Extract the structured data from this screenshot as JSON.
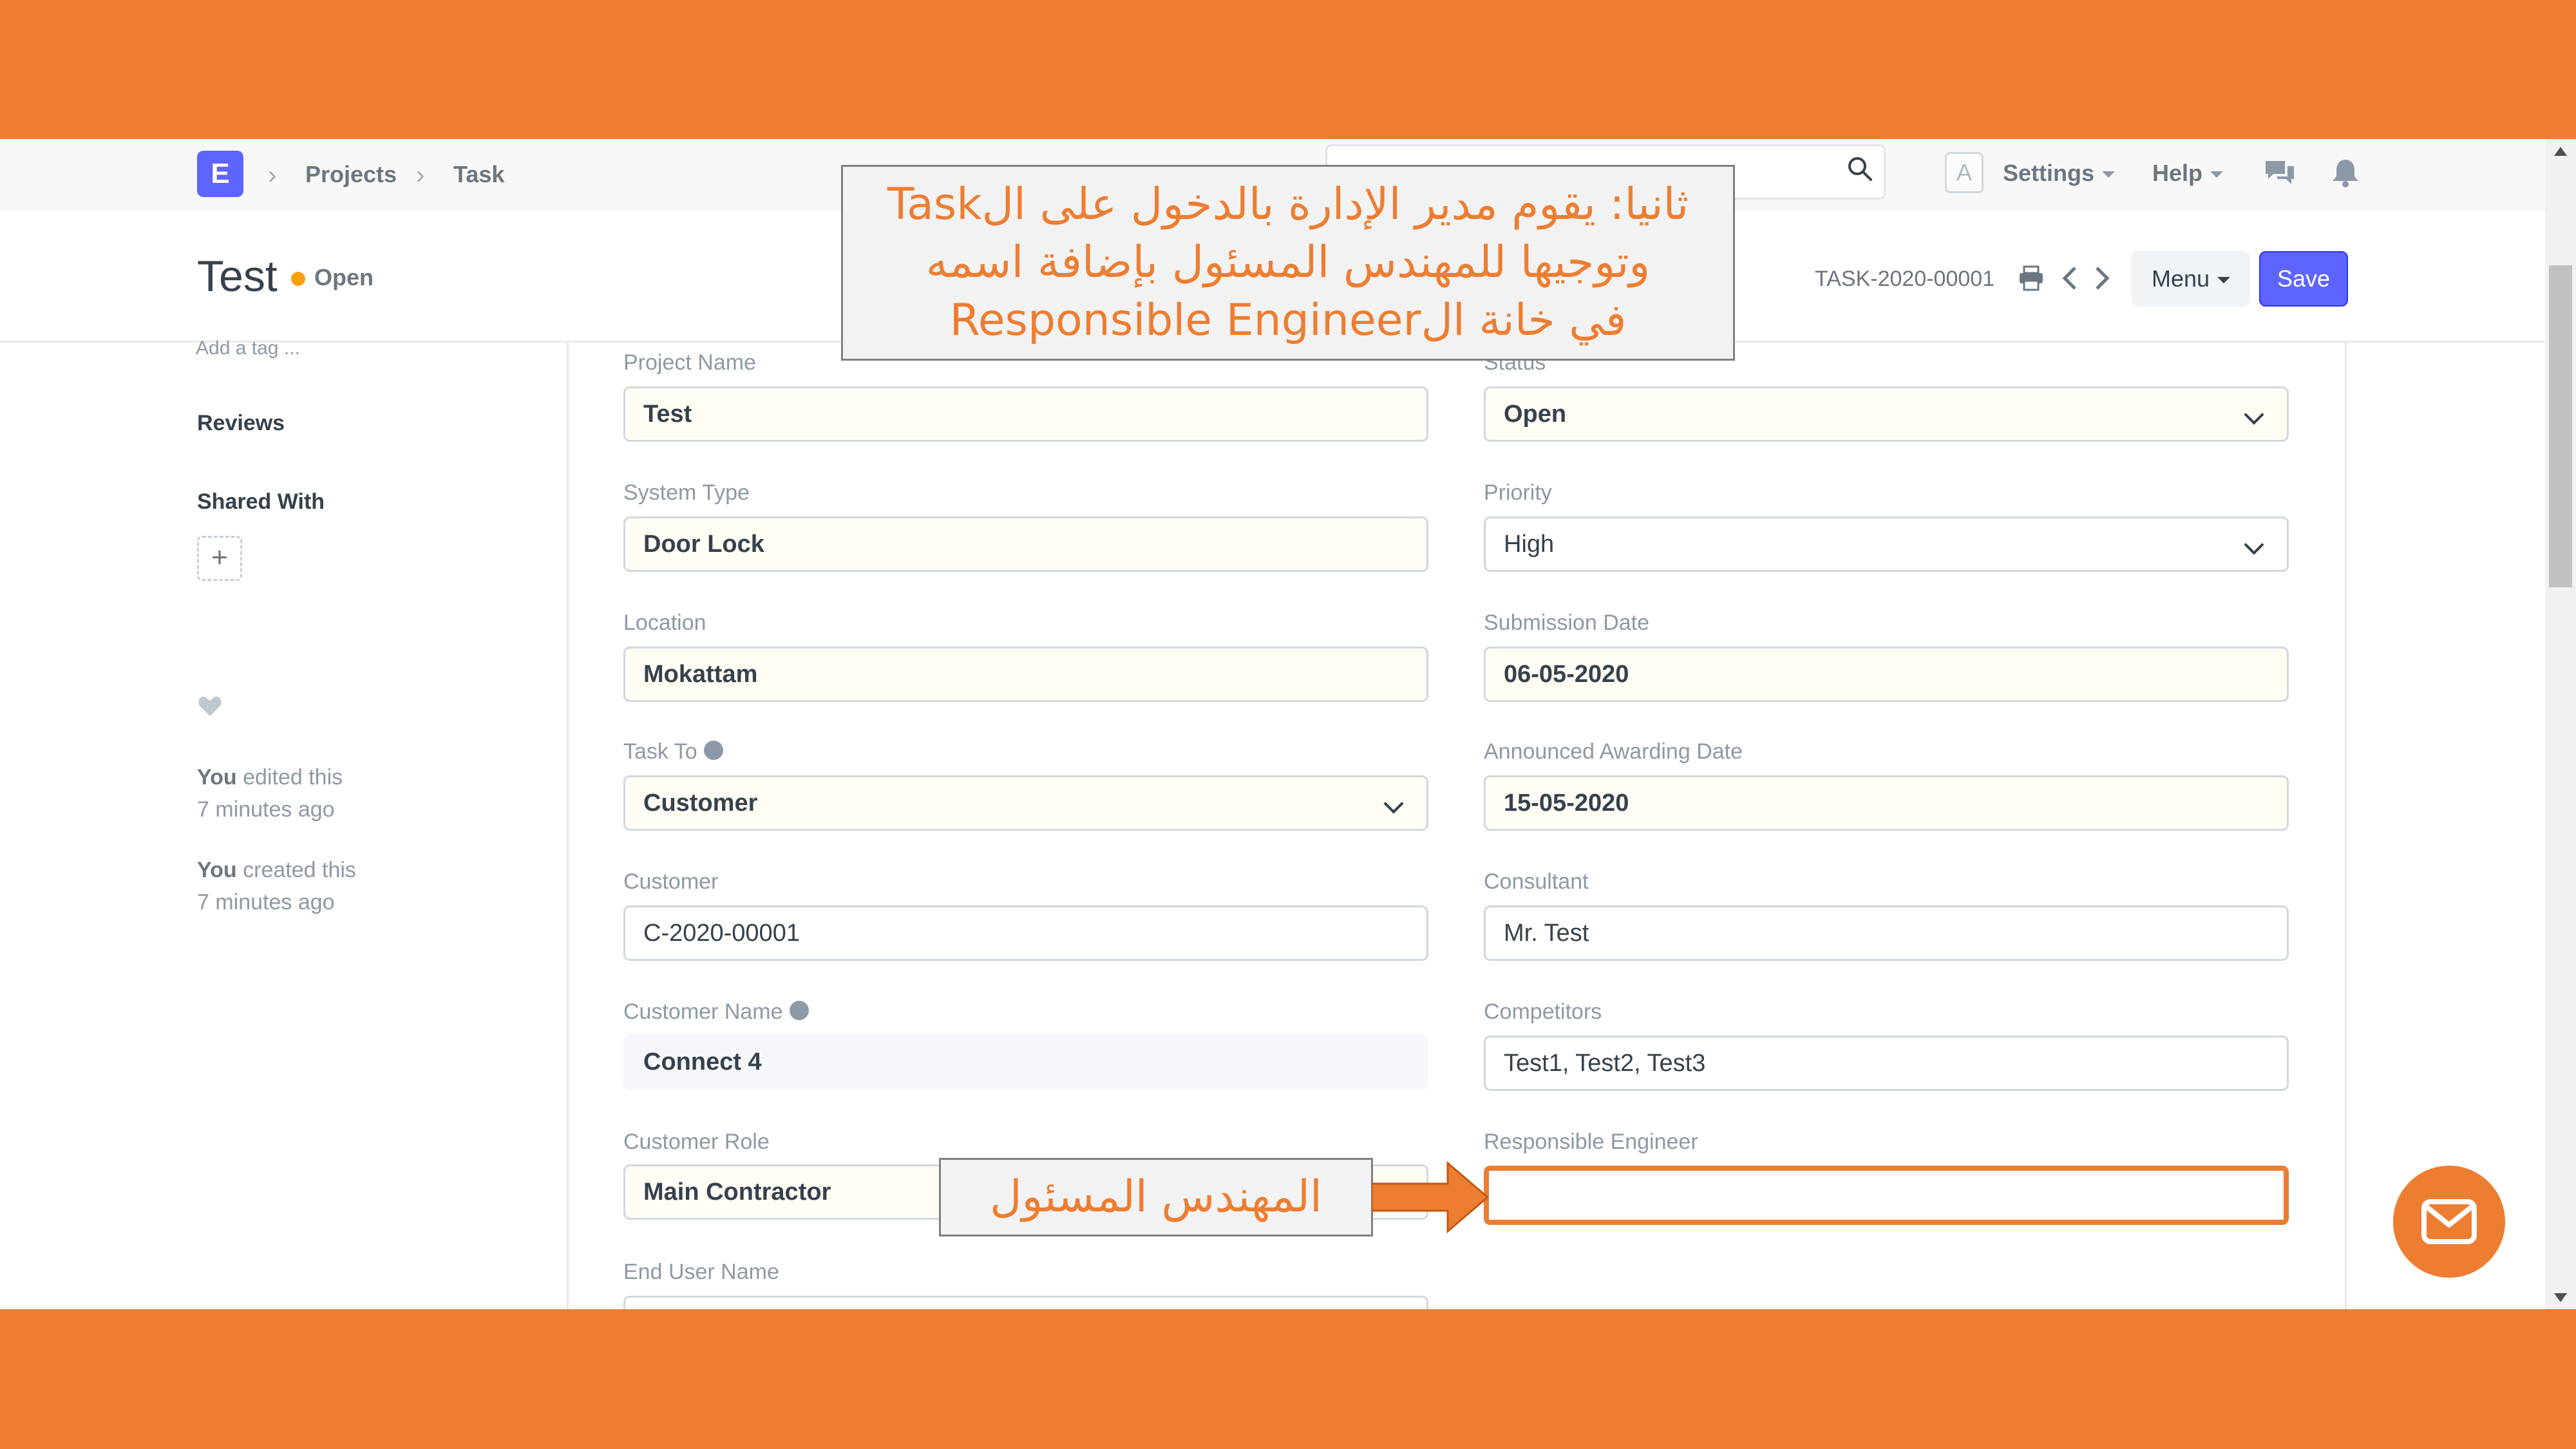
{
  "navbar": {
    "logo_letter": "E",
    "breadcrumbs": [
      "Projects",
      "Task"
    ],
    "avatar_letter": "A",
    "settings_label": "Settings",
    "help_label": "Help"
  },
  "page": {
    "title": "Test",
    "status": "Open",
    "doc_name": "TASK-2020-00001",
    "menu_label": "Menu",
    "save_label": "Save",
    "colors": {
      "primary": "#5e64ff",
      "status_dot": "#ffa00a",
      "highlight": "#ED7D31"
    }
  },
  "sidebar": {
    "add_tag": "Add a tag ...",
    "reviews": "Reviews",
    "shared_with": "Shared With",
    "add_share": "+",
    "activity": [
      {
        "who": "You",
        "action": " edited this",
        "when": "7 minutes ago"
      },
      {
        "who": "You",
        "action": " created this",
        "when": "7 minutes ago"
      }
    ]
  },
  "form": {
    "left": [
      {
        "label": "Project Name",
        "value": "Test"
      },
      {
        "label": "System Type",
        "value": "Door Lock"
      },
      {
        "label": "Location",
        "value": "Mokattam"
      },
      {
        "label": "Task To",
        "value": "Customer"
      },
      {
        "label": "Customer",
        "value": "C-2020-00001"
      },
      {
        "label": "Customer Name",
        "value": "Connect 4"
      },
      {
        "label": "Customer Role",
        "value": "Main Contractor"
      },
      {
        "label": "End User Name",
        "value": ""
      }
    ],
    "right": [
      {
        "label": "Status",
        "value": "Open"
      },
      {
        "label": "Priority",
        "value": "High"
      },
      {
        "label": "Submission Date",
        "value": "06-05-2020"
      },
      {
        "label": "Announced Awarding Date",
        "value": "15-05-2020"
      },
      {
        "label": "Consultant",
        "value": "Mr. Test"
      },
      {
        "label": "Competitors",
        "value": "Test1, Test2, Test3"
      },
      {
        "label": "Responsible Engineer",
        "value": ""
      }
    ]
  },
  "annotations": {
    "top_callout": [
      "ثانيا: يقوم مدير الإدارة بالدخول على الTask",
      "وتوجيها للمهندس المسئول بإضافة اسمه",
      "في خانة الResponsible Engineer"
    ],
    "field_callout": "المهندس المسئول"
  }
}
